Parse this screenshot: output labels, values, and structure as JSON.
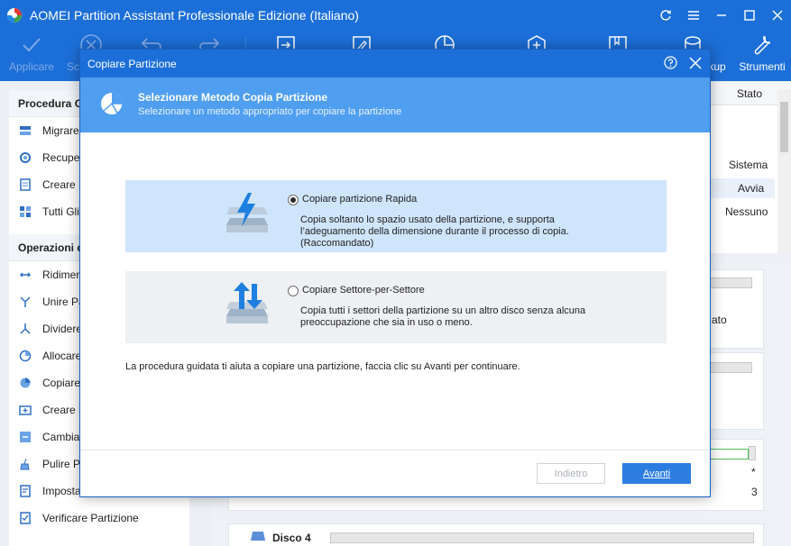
{
  "app": {
    "title": "AOMEI Partition Assistant Professionale Edizione (Italiano)"
  },
  "toolbar": {
    "apply_label": "Applicare",
    "undo_label": "Sc",
    "backup_label": "kup",
    "tools_label": "Strumenti"
  },
  "left_panel": {
    "section1": "Procedura G",
    "wizard_items": [
      "Migrare",
      "Recuper",
      "Creare M",
      "Tutti Gli S"
    ],
    "section2": "Operazioni d",
    "op_items": [
      "Ridimens",
      "Unire Pa",
      "Dividere",
      "Allocare",
      "Copiare",
      "Creare P",
      "Cambiare",
      "Pulire Pa",
      "Impostar",
      "Verificare Partizione"
    ]
  },
  "partition_list": {
    "col_status": "Stato",
    "status_values": [
      "Sistema",
      "Avvia",
      "Nessuno"
    ]
  },
  "disk_area": {
    "side_text_1": "ato",
    "side_text_2": "*",
    "side_text_3": "3",
    "disk4_label": "Disco 4"
  },
  "dialog": {
    "title": "Copiare Partizione",
    "header_title": "Selezionare Metodo Copia Partizione",
    "header_subtitle": "Selezionare un metodo appropriato per copiare la partizione",
    "option_fast": {
      "label": "Copiare partizione Rapida",
      "description": "Copia soltanto lo spazio usato della partizione, e supporta l’adeguamento della dimensione durante il processo di copia.(Raccomandato)",
      "selected": true
    },
    "option_sector": {
      "label": "Copiare Settore-per-Settore",
      "description": "Copia tutti i settori della partizione su un altro disco senza alcuna preoccupazione che sia in uso o meno.",
      "selected": false
    },
    "info_text": "La procedura guidata ti aiuta a copiare una partizione, faccia clic su Avanti per continuare.",
    "back_label": "Indietro",
    "next_label": "Avanti"
  },
  "colors": {
    "brand_blue": "#1c6fd8",
    "header_blue": "#4f9ef0",
    "selected_option_bg": "#cfe5fb",
    "button_blue": "#2d7de0"
  }
}
